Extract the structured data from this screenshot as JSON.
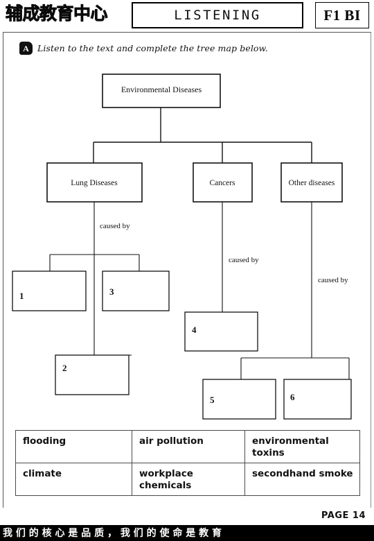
{
  "header": {
    "logo_cn": "辅成教育中心",
    "section_title": "LISTENING",
    "level_code": "F1 BI"
  },
  "instruction": {
    "badge": "A",
    "text": "Listen to the text and complete the tree map below."
  },
  "tree": {
    "root": "Environmental Diseases",
    "children": [
      {
        "label": "Lung Diseases"
      },
      {
        "label": "Cancers"
      },
      {
        "label": "Other diseases"
      }
    ],
    "edge_labels": {
      "lung": "caused by",
      "cancers": "caused by",
      "other": "caused by"
    },
    "answer_boxes": [
      {
        "number": "1"
      },
      {
        "number": "2"
      },
      {
        "number": "3"
      },
      {
        "number": "4"
      },
      {
        "number": "5"
      },
      {
        "number": "6"
      }
    ]
  },
  "wordbank": {
    "rows": [
      [
        "flooding",
        "air pollution",
        "environmental toxins"
      ],
      [
        "climate",
        "workplace chemicals",
        "secondhand smoke"
      ]
    ]
  },
  "footer": {
    "page_label": "PAGE 14",
    "banner": "我 们 的 核 心 是 品 质 ， 我 们 的 使 命 是 教 育"
  }
}
